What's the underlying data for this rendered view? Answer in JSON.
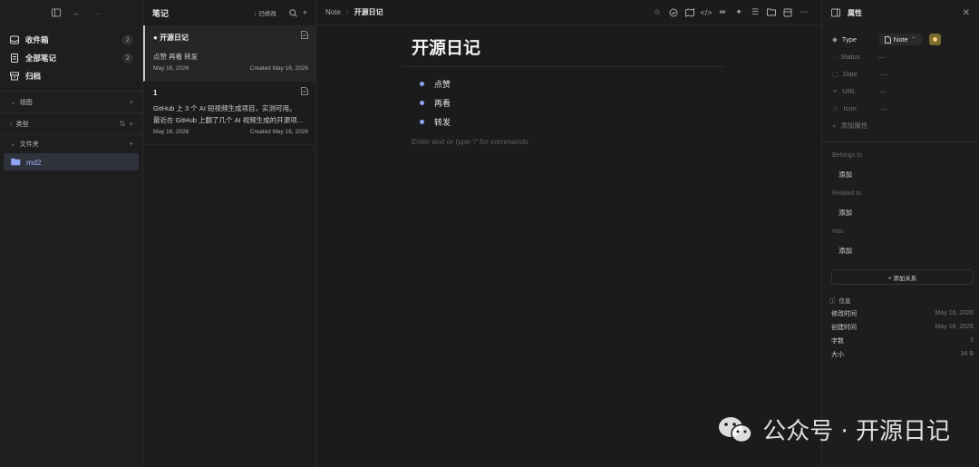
{
  "sidebar": {
    "nav": [
      {
        "label": "收件箱",
        "badge": "2"
      },
      {
        "label": "全部笔记",
        "badge": "2"
      },
      {
        "label": "归档",
        "badge": ""
      }
    ],
    "sections": [
      {
        "label": "视图"
      },
      {
        "label": "类型"
      },
      {
        "label": "文件夹"
      }
    ],
    "folder": "md2"
  },
  "notelist": {
    "title": "笔记",
    "sort_label": "已修改",
    "notes": [
      {
        "title": "开源日记",
        "body1": "点赞 再看 转发",
        "body2": "",
        "date": "May 16, 2026",
        "created": "Created May 16, 2026"
      },
      {
        "title": "1",
        "body1": "GitHub 上 3 个 AI 短视频生成项目，实测可用。",
        "body2": "最近在 GitHub 上翻了几个 AI 视频生成的开源项...",
        "date": "May 16, 2026",
        "created": "Created May 16, 2026"
      }
    ]
  },
  "editor": {
    "breadcrumb_root": "Note",
    "breadcrumb_sep": "›",
    "breadcrumb_current": "开源日记",
    "title": "开源日记",
    "bullets": [
      "点赞",
      "再看",
      "转发"
    ],
    "placeholder": "Enter text or type '/' for commands"
  },
  "props": {
    "title": "属性",
    "type_key": "Type",
    "type_value": "Note",
    "rows": [
      {
        "key": "Status",
        "value": "—"
      },
      {
        "key": "Date",
        "value": "—"
      },
      {
        "key": "URL",
        "value": "—"
      },
      {
        "key": "Icon",
        "value": "—"
      }
    ],
    "add_property": "添加属性",
    "belongs_to": "Belongs to",
    "related_to": "Related to",
    "has": "Has",
    "add": "添加",
    "add_relation": "+ 添加关系",
    "info_title": "信息",
    "info": [
      {
        "key": "修改时间",
        "value": "May 16, 2026"
      },
      {
        "key": "创建时间",
        "value": "May 16, 2026"
      },
      {
        "key": "字数",
        "value": "3"
      },
      {
        "key": "大小",
        "value": "34 B"
      }
    ]
  },
  "watermark": {
    "text": "公众号 · 开源日记"
  },
  "colors": {
    "accent": "#8ea4f5",
    "folder_bg": "#2e323b",
    "type_icon": "#f0d27a"
  }
}
